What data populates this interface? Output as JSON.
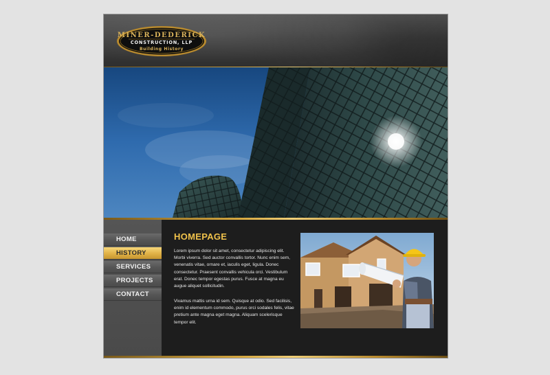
{
  "brand": {
    "name": "MINER-DEDERICK",
    "subtitle": "CONSTRUCTION, LLP",
    "tagline": "Building History",
    "accent_color": "#f0c24b"
  },
  "nav": {
    "items": [
      {
        "label": "HOME",
        "active": false
      },
      {
        "label": "HISTORY",
        "active": true
      },
      {
        "label": "SERVICES",
        "active": false
      },
      {
        "label": "PROJECTS",
        "active": false
      },
      {
        "label": "CONTACT",
        "active": false
      }
    ]
  },
  "content": {
    "title": "HOMEPAGE",
    "paragraphs": [
      "Lorem ipsum dolor sit amet, consectetur adipiscing elit. Morbi viverra. Sed auctor convallis tortor. Nunc enim sem, venenatis vitae, ornare et, iaculis eget, ligula. Donec consectetur. Praesent convallis vehicula orci. Vestibulum erat. Donec tempor egestas purus. Fusce at magna eu augue aliquet sollicitudin.",
      "Vivamus mattis urna id sem. Quisque at odio. Sed facilisis, enim id elementum commodo, purus orci sodales felis, vitae pretium ante magna eget magna. Aliquam scelerisque tempor elit."
    ]
  },
  "images": {
    "hero": "glass-skyscraper-photo",
    "feature": "construction-worker-house-photo"
  }
}
